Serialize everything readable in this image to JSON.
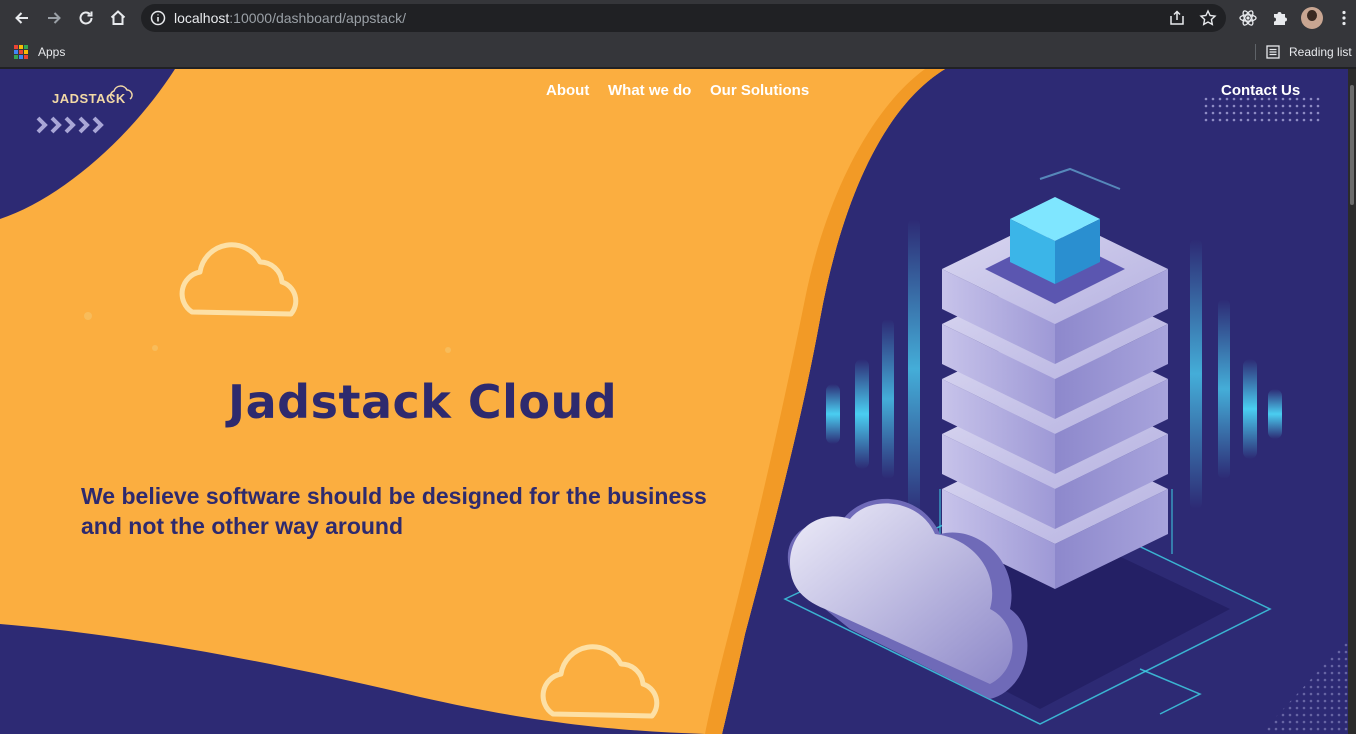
{
  "browser": {
    "url_host": "localhost",
    "url_rest": ":10000/dashboard/appstack/",
    "bookmarks": {
      "apps_label": "Apps",
      "reading_list_label": "Reading list"
    }
  },
  "site": {
    "logo_text": "JADSTACK",
    "nav": {
      "about": "About",
      "what_we_do": "What we do",
      "our_solutions": "Our Solutions",
      "contact": "Contact Us"
    },
    "hero": {
      "title": "Jadstack Cloud",
      "subtitle": "We believe software should be designed for the business and not the other way around"
    }
  },
  "colors": {
    "navy": "#2d2a74",
    "orange": "#fbae40",
    "orange_dark": "#f29a26",
    "text_dark": "#2e2a6e"
  },
  "icons": {
    "back": "arrow-left-icon",
    "forward": "arrow-right-icon",
    "reload": "reload-icon",
    "home": "home-icon",
    "info": "info-icon",
    "share": "share-icon",
    "bookmark": "star-icon",
    "extension1": "react-icon",
    "extensions": "puzzle-icon",
    "menu": "kebab-menu-icon"
  }
}
